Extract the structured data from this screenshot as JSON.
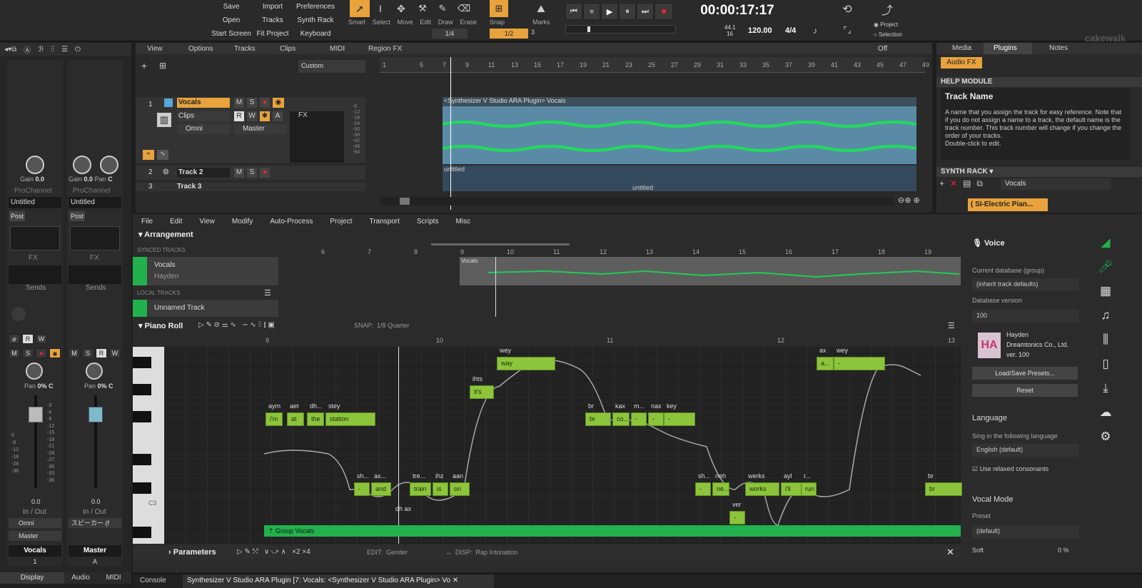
{
  "top": {
    "file_btns": [
      "Save",
      "Import",
      "Preferences",
      "Open",
      "Tracks",
      "Synth Rack",
      "Start Screen",
      "Fit Project",
      "Keyboard"
    ],
    "tools": [
      "Smart",
      "Select",
      "Move",
      "Edit",
      "Draw",
      "Erase"
    ],
    "snap_label": "Snap",
    "snap_val": "1/4",
    "snap_val2": "1/2",
    "snap_num": "3",
    "marks_label": "Marks",
    "time": "00:00:17:17",
    "rate_top": "44.1",
    "rate_bot": "16",
    "tempo": "120.00",
    "meter": "4/4",
    "project_radio": "Project",
    "selection_radio": "Selection",
    "brand": "cakewalk"
  },
  "tracks_menu": [
    "View",
    "Options",
    "Tracks",
    "Clips",
    "MIDI",
    "Region FX"
  ],
  "off_label": "Off",
  "custom_label": "Custom",
  "timeline_ticks": [
    "1",
    "5",
    "7",
    "9",
    "11",
    "13",
    "15",
    "17",
    "19",
    "21",
    "23",
    "25",
    "27",
    "29",
    "31",
    "33",
    "35",
    "37",
    "39",
    "41",
    "43",
    "45",
    "47",
    "49"
  ],
  "track1": {
    "num": "1",
    "name": "Vocals",
    "clips": "Clips",
    "input": "Omni",
    "output": "Master",
    "fx": "FX",
    "clip_title": "<Synthesizer V Studio ARA Plugin> Vocals"
  },
  "track2": {
    "num": "2",
    "name": "Track 2",
    "clip": "untitled",
    "clip2": "untitled"
  },
  "track3": {
    "num": "3",
    "name": "Track 3"
  },
  "db_ticks": [
    "-6",
    "-12",
    "-18",
    "-24",
    "-30",
    "-36",
    "-42",
    "-48",
    "-54"
  ],
  "strip1": {
    "gain": "Gain",
    "gain_val": "0.0",
    "prochannel": "ProChannel",
    "preset": "Untitled",
    "post": "Post",
    "fx": "FX",
    "sends": "Sends",
    "pan": "Pan",
    "pan_val": "0% C",
    "vol": "0.0",
    "io": "In / Out",
    "input": "Omni",
    "output": "Master",
    "name": "Vocals",
    "num": "1"
  },
  "strip2": {
    "gain": "Gain",
    "gain_val": "0.0",
    "pan_lbl": "Pan",
    "pan_v": "C",
    "prochannel": "ProChannel",
    "preset": "Untitled",
    "post": "Post",
    "fx": "FX",
    "sends": "Sends",
    "pan": "Pan",
    "pan_val": "0% C",
    "vol": "0.0",
    "io": "In / Out",
    "output": "スピーカー (f",
    "name": "Master",
    "num": "A"
  },
  "fader_scale": [
    "-3",
    "-6",
    "-9",
    "-12",
    "-15",
    "-18",
    "-21",
    "-24",
    "-27",
    "-30",
    "-33",
    "-36",
    "-39"
  ],
  "fader_scale2": [
    "0",
    "-6",
    "-12",
    "-18",
    "-24",
    "-36"
  ],
  "bottom_tabs": [
    "Display",
    "Audio",
    "MIDI"
  ],
  "right": {
    "tabs": [
      "Media",
      "Plugins",
      "Notes"
    ],
    "audio_fx": "Audio FX",
    "help_title": "HELP MODULE",
    "help_head": "Track Name",
    "help_text": "A name that you assign the track for easy reference. Note that if you do not assign a name to a track, the default name is the track number. This track number will change if you change the order of your tracks.\nDouble-click to edit.",
    "synth_rack": "SYNTH RACK",
    "synth_sel": "Vocals",
    "synth_item": "( SI-Electric Pian..."
  },
  "sv": {
    "menu": [
      "File",
      "Edit",
      "View",
      "Modify",
      "Auto-Process",
      "Project",
      "Transport",
      "Scripts",
      "Misc"
    ],
    "arrangement": "Arrangement",
    "synced": "SYNCED TRACKS",
    "local": "LOCAL TRACKS",
    "track_vocals": "Vocals",
    "track_singer": "Hayden",
    "unnamed": "Unnamed Track",
    "clip_label": "Vocals",
    "arr_ticks": [
      "6",
      "7",
      "8",
      "9",
      "10",
      "11",
      "12",
      "13",
      "14",
      "15",
      "16",
      "17",
      "18",
      "19"
    ],
    "pianoroll": "Piano Roll",
    "snap": "SNAP:",
    "snap_val": "1/8 Quarter",
    "pr_ticks": [
      "9",
      "10",
      "11",
      "12",
      "13"
    ],
    "c3": "C3",
    "group": "⇡ Group Vocals",
    "params": "Parameters",
    "edit": "EDIT:",
    "edit_val": "Gender",
    "disp": "DISP:",
    "disp_val": "Rap Intonation"
  },
  "notes": [
    {
      "w": "i'm",
      "p": "aym"
    },
    {
      "w": "at",
      "p": "aet"
    },
    {
      "w": "the",
      "p": "dh..."
    },
    {
      "w": "station",
      "p": "stey"
    },
    {
      "w": "-",
      "p": "sh..."
    },
    {
      "w": "and",
      "p": "ax..."
    },
    {
      "w": "train",
      "p": "tre..."
    },
    {
      "w": "is",
      "p": "ihz"
    },
    {
      "w": "on",
      "p": "aan"
    },
    {
      "w": "it's",
      "p": "ihts"
    },
    {
      "w": "way",
      "p": "wey"
    },
    {
      "w": "br",
      "p": "br"
    },
    {
      "w": "co...",
      "p": "kax"
    },
    {
      "w": "-",
      "p": "m..."
    },
    {
      "w": "-",
      "p": "nax"
    },
    {
      "w": "-",
      "p": "key"
    },
    {
      "w": "-",
      "p": "sh..."
    },
    {
      "w": "ne...",
      "p": "neh"
    },
    {
      "w": "-",
      "p": "ver"
    },
    {
      "w": "works",
      "p": "werks"
    },
    {
      "w": "i'll",
      "p": "ayl"
    },
    {
      "w": "run",
      "p": "r..."
    },
    {
      "w": "a...",
      "p": "ax"
    },
    {
      "w": "-",
      "p": "wey"
    },
    {
      "w": "br",
      "p": "br"
    },
    {
      "w": "",
      "p": "dh ax"
    }
  ],
  "voice": {
    "title": "Voice",
    "db_group": "Current database (group)",
    "db_group_val": "(inherit track defaults)",
    "db_ver": "Database version",
    "db_ver_val": "100",
    "singer": "Hayden",
    "company": "Dreamtonics Co., Ltd.",
    "ver": "ver. 100",
    "load": "Load/Save Presets...",
    "reset": "Reset",
    "language": "Language",
    "sing_in": "Sing in the following language",
    "lang_val": "English (default)",
    "relaxed": "Use relaxed consonants",
    "vocal_mode": "Vocal Mode",
    "preset": "Preset",
    "preset_val": "(default)",
    "soft": "Soft",
    "soft_val": "0 %"
  },
  "statusbar": {
    "console": "Console",
    "tab": "Synthesizer V Studio ARA Plugin [7: Vocals: <Synthesizer V Studio ARA Plugin> Vo"
  },
  "colors": {
    "accent": "#e8a33c",
    "green": "#22b14c",
    "note": "#8cc43c",
    "bg": "#1e1e1e"
  }
}
